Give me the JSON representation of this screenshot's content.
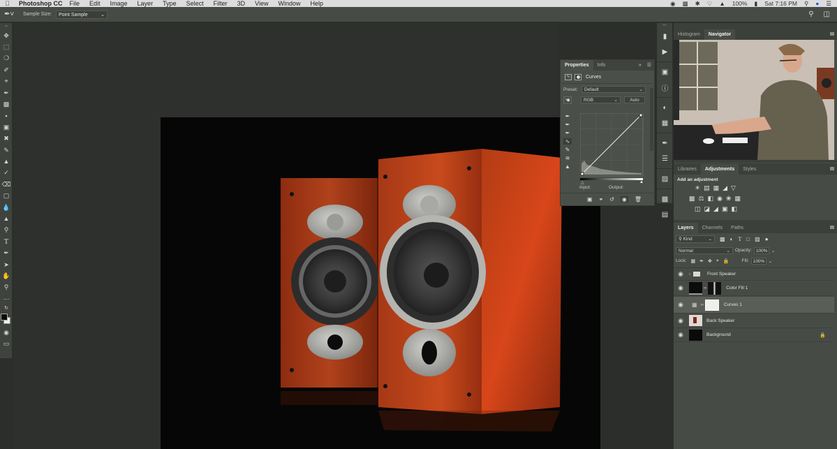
{
  "menubar": {
    "app_name": "Photoshop CC",
    "items": [
      "File",
      "Edit",
      "Image",
      "Layer",
      "Type",
      "Select",
      "Filter",
      "3D",
      "View",
      "Window",
      "Help"
    ],
    "battery": "100%",
    "clock": "Sat 7:16 PM"
  },
  "options_bar": {
    "tool_icon": "eyedropper-icon",
    "sample_size_label": "Sample Size:",
    "sample_size_value": "Point Sample"
  },
  "toolbar": {
    "tools": [
      "move",
      "rectangular-marquee",
      "lasso",
      "quick-selection",
      "crop",
      "eyedropper",
      "spot-healing",
      "brush",
      "clone-stamp",
      "history-brush",
      "eraser",
      "gradient",
      "blur",
      "dodge",
      "pen",
      "type",
      "path-selection",
      "hand",
      "zoom",
      "more",
      "swap-colors",
      "foreground-background",
      "quick-mask",
      "screen-mode"
    ]
  },
  "properties_panel": {
    "tabs": [
      {
        "label": "Properties",
        "active": true
      },
      {
        "label": "Info",
        "active": false
      }
    ],
    "title": "Curves",
    "preset_label": "Preset:",
    "preset_value": "Default",
    "channel_value": "RGB",
    "auto_label": "Auto",
    "input_label": "Input:",
    "output_label": "Output:",
    "curve_points": [
      [
        0,
        0
      ],
      [
        255,
        255
      ]
    ]
  },
  "navigator_panel": {
    "tabs": [
      {
        "label": "Histogram",
        "active": false
      },
      {
        "label": "Navigator",
        "active": true
      }
    ]
  },
  "adjustments_panel": {
    "tabs": [
      {
        "label": "Libraries",
        "active": false
      },
      {
        "label": "Adjustments",
        "active": true
      },
      {
        "label": "Styles",
        "active": false
      }
    ],
    "heading": "Add an adjustment",
    "rows": [
      [
        "brightness-contrast",
        "levels",
        "curves",
        "exposure",
        "vibrance"
      ],
      [
        "hue-saturation",
        "color-balance",
        "black-white",
        "photo-filter",
        "channel-mixer",
        "color-lookup"
      ],
      [
        "invert",
        "posterize",
        "threshold",
        "selective-color",
        "gradient-map"
      ]
    ]
  },
  "layers_panel": {
    "tabs": [
      {
        "label": "Layers",
        "active": true
      },
      {
        "label": "Channels",
        "active": false
      },
      {
        "label": "Paths",
        "active": false
      }
    ],
    "filter_value": "Kind",
    "blend_mode": "Normal",
    "opacity_label": "Opacity:",
    "opacity_value": "100%",
    "lock_label": "Lock:",
    "fill_label": "Fill:",
    "fill_value": "100%",
    "layers": [
      {
        "name": "Front Speaker",
        "type": "group",
        "visible": true,
        "selected": false
      },
      {
        "name": "Color Fill 1",
        "type": "fill",
        "visible": true,
        "selected": false
      },
      {
        "name": "Curves 1",
        "type": "adjustment",
        "visible": true,
        "selected": true
      },
      {
        "name": "Back Speaker",
        "type": "smart-object",
        "visible": true,
        "selected": false
      },
      {
        "name": "Background",
        "type": "background",
        "visible": true,
        "selected": false,
        "locked": true
      }
    ]
  },
  "colors": {
    "panel_bg": "#474b45",
    "menubar_bg": "#dcdcdf",
    "speaker_wood": "#b8401c"
  }
}
